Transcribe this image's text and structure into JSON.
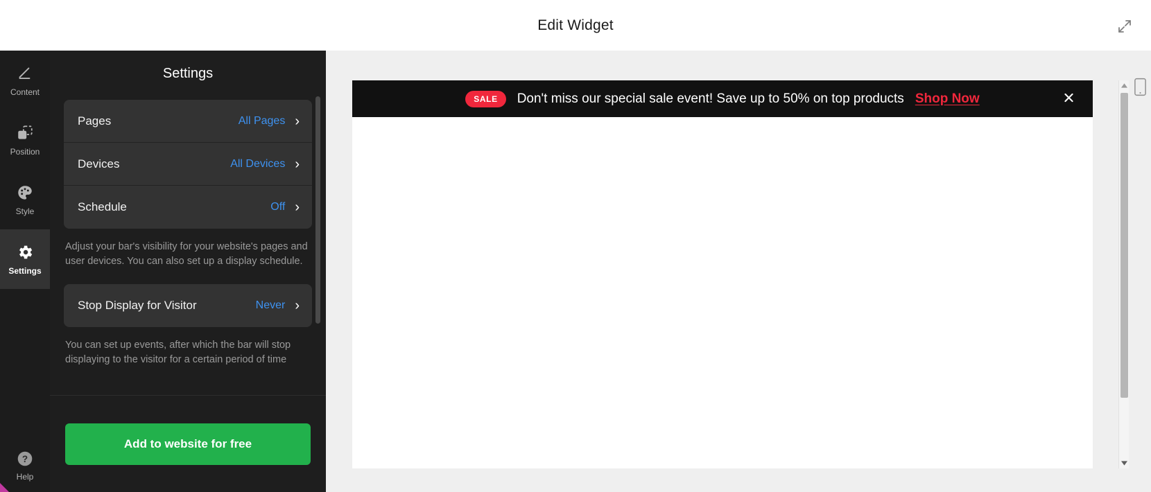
{
  "header": {
    "title": "Edit Widget",
    "expand_icon": "expand-arrows-icon"
  },
  "rail": {
    "items": [
      {
        "label": "Content",
        "icon": "pencil-icon",
        "active": false
      },
      {
        "label": "Position",
        "icon": "position-icon",
        "active": false
      },
      {
        "label": "Style",
        "icon": "palette-icon",
        "active": false
      },
      {
        "label": "Settings",
        "icon": "gear-icon",
        "active": true
      }
    ],
    "help": {
      "label": "Help",
      "icon": "question-circle-icon"
    }
  },
  "panel": {
    "title": "Settings",
    "visibility_rows": [
      {
        "label": "Pages",
        "value": "All Pages"
      },
      {
        "label": "Devices",
        "value": "All Devices"
      },
      {
        "label": "Schedule",
        "value": "Off"
      }
    ],
    "visibility_help": "Adjust your bar's visibility for your website's pages and user devices. You can also set up a display schedule.",
    "stop_display_rows": [
      {
        "label": "Stop Display for Visitor",
        "value": "Never"
      }
    ],
    "stop_display_help": "You can set up events, after which the bar will stop displaying to the visitor for a certain period of time",
    "cta_label": "Add to website for free",
    "chevron": "›"
  },
  "preview": {
    "bar": {
      "badge": "SALE",
      "message": "Don't miss our special sale event! Save up to 50% on top products",
      "link": "Shop Now",
      "close_icon": "close-icon",
      "background": "#111111",
      "badge_color": "#f0273c",
      "link_color": "#f0273c"
    },
    "device_toggle_icon": "mobile-phone-icon",
    "scroll_up_icon": "triangle-up-icon",
    "scroll_down_icon": "triangle-down-icon"
  },
  "colors": {
    "accent_blue": "#3e92f0",
    "cta_green": "#22b14c",
    "panel_bg": "#1e1e1e",
    "rail_bg": "#1c1c1c",
    "card_bg": "#333333"
  }
}
